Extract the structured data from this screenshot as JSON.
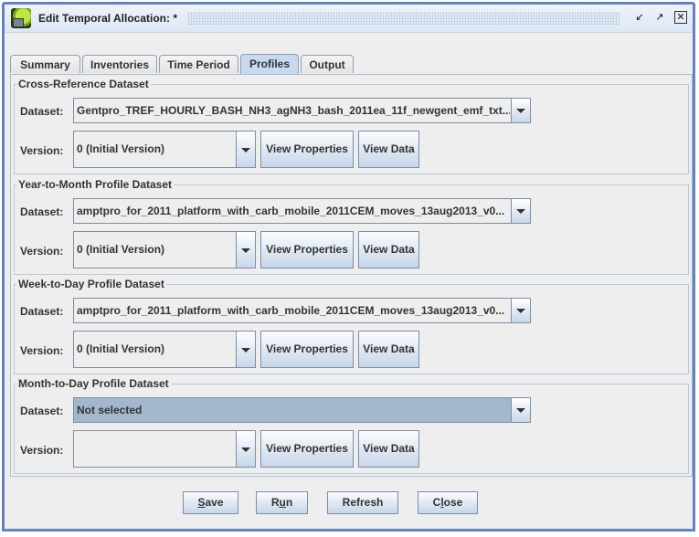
{
  "window": {
    "title": "Edit Temporal Allocation: *",
    "icon": "app-logo-icon",
    "controls": {
      "minimize": "minimize-icon",
      "maximize": "maximize-icon",
      "close": "close-icon"
    }
  },
  "tabs": [
    {
      "label": "Summary",
      "active": false
    },
    {
      "label": "Inventories",
      "active": false
    },
    {
      "label": "Time Period",
      "active": false
    },
    {
      "label": "Profiles",
      "active": true
    },
    {
      "label": "Output",
      "active": false
    }
  ],
  "groups": [
    {
      "title": "Cross-Reference Dataset",
      "dataset_label": "Dataset:",
      "dataset_value": "Gentpro_TREF_HOURLY_BASH_NH3_agNH3_bash_2011ea_11f_newgent_emf_txt...",
      "version_label": "Version:",
      "version_value": "0 (Initial Version)",
      "view_properties": "View Properties",
      "view_data": "View Data"
    },
    {
      "title": "Year-to-Month Profile Dataset",
      "dataset_label": "Dataset:",
      "dataset_value": "amptpro_for_2011_platform_with_carb_mobile_2011CEM_moves_13aug2013_v0...",
      "version_label": "Version:",
      "version_value": "0 (Initial Version)",
      "view_properties": "View Properties",
      "view_data": "View Data"
    },
    {
      "title": "Week-to-Day Profile Dataset",
      "dataset_label": "Dataset:",
      "dataset_value": "amptpro_for_2011_platform_with_carb_mobile_2011CEM_moves_13aug2013_v0...",
      "version_label": "Version:",
      "version_value": "0 (Initial Version)",
      "view_properties": "View Properties",
      "view_data": "View Data"
    },
    {
      "title": "Month-to-Day Profile Dataset",
      "dataset_label": "Dataset:",
      "dataset_value": "Not selected",
      "version_label": "Version:",
      "version_value": "",
      "view_properties": "View Properties",
      "view_data": "View Data"
    }
  ],
  "footer": {
    "save": {
      "mnemonic": "S",
      "rest": "ave"
    },
    "run": {
      "pre": "R",
      "mnemonic": "u",
      "rest": "n"
    },
    "refresh": "Refresh",
    "close": {
      "pre": "C",
      "mnemonic": "l",
      "rest": "ose"
    }
  }
}
